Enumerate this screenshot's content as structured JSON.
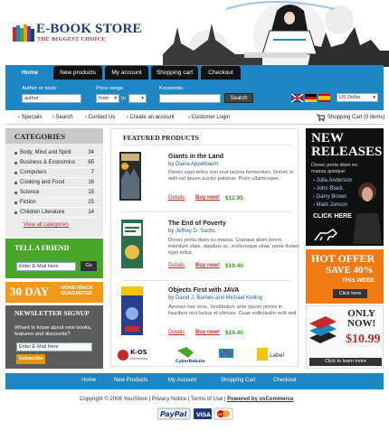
{
  "brand": {
    "title": "E-BOOK STORE",
    "subtitle": "THE BIGGEST CHOICE"
  },
  "nav": {
    "tabs": [
      "Home",
      "New products",
      "My account",
      "Shopping cart",
      "Checkout"
    ]
  },
  "search": {
    "author_label": "Author or book:",
    "author_value": "author",
    "price_label": "Price range:",
    "price_from": "from",
    "price_to": "to",
    "keywords_label": "Keywords:",
    "button": "Search",
    "currency": "US Dollar"
  },
  "subnav": {
    "items": [
      "Specials",
      "Search",
      "Contact Us",
      "Create an account",
      "Customer Login"
    ],
    "cart": "Shopping Cart (0 items)"
  },
  "categories": {
    "title": "CATEGORIES",
    "items": [
      {
        "label": "Body, Mind and Spirit",
        "count": "34"
      },
      {
        "label": "Business & Economics",
        "count": "65"
      },
      {
        "label": "Computers",
        "count": "7"
      },
      {
        "label": "Cooking and Food",
        "count": "16"
      },
      {
        "label": "Science",
        "count": "15"
      },
      {
        "label": "Fiction",
        "count": "25"
      },
      {
        "label": "Children Literature",
        "count": "14"
      }
    ],
    "view_all": "View all categories"
  },
  "tell_friend": {
    "title": "TELL A FRIEND",
    "placeholder": "Enter E-Mail Here",
    "button": "Go"
  },
  "guarantee": {
    "big": "30 DAY",
    "line1": "MONEYBACK",
    "line2": "GUARANTEE"
  },
  "newsletter": {
    "title": "NEWSLETTER SIGNUP",
    "text": "Whant to know about new books, features and discounts?",
    "placeholder": "Enter E-Mail Here",
    "button": "Subscribe"
  },
  "featured": {
    "title": "FEATURED PRODUCTS",
    "products": [
      {
        "title": "Giants in the Land",
        "author": "by Diana Appelbaum",
        "desc": "Donec eget tellus non erat lacinia fermentum. Donec in velit vel ipsum auctor pulvinar. Proin ullamcorper.",
        "details": "Details",
        "buy": "Buy now!",
        "price": "$12.95",
        "cover_title": "GIANTS IN THE LAND"
      },
      {
        "title": "The End of Poverty",
        "author": "by Jeffrey D. Sachs",
        "desc": "Donec porta diam eu massa. Quisque diam lorem, interdum vitae, dapibus ac, scelerisque vitae, pede donec eget tellus.",
        "details": "Details",
        "buy": "Buy now!",
        "price": "$19.40",
        "cover_title": "THE END OF POVERTY"
      },
      {
        "title": "Objects First with JAVA",
        "author": "by David J. Barnes and Michael Kolling",
        "desc": "Aenean nec eros. Vestibulum ante ipsum primis in faucibus orci luctus et ultrices. Cuae sollicitudin velit sed.",
        "details": "Details",
        "buy": "Buy now!",
        "price": "$19.40",
        "cover_title": "Objects First with Java"
      }
    ],
    "partners": [
      "K-OS Multimedia",
      "CyberRebate",
      "Web Search",
      "Label"
    ]
  },
  "promos": {
    "new_releases": {
      "title1": "NEW",
      "title2": "RELEASES",
      "text": "Donec porta diam eu massa quisque:",
      "authors": [
        "Julia Anderson",
        "John Black",
        "Garry Brown",
        "Mark Jonson"
      ],
      "cta": "CLICK HERE"
    },
    "hot_offer": {
      "title": "HOT OFFER",
      "save": "SAVE 40%",
      "week": "THIS WEEK",
      "cta": "Click here"
    },
    "only_now": {
      "line1": "ONLY",
      "line2": "NOW!",
      "price": "$10.99",
      "cta": "Click to learn more"
    }
  },
  "footer": {
    "links": [
      "Home",
      "New Products",
      "My Account",
      "Shopping Cart",
      "Checkout"
    ],
    "copyright": "Copyright © 2006 YourStore",
    "privacy": "Privacy Notice",
    "terms": "Terms of Use",
    "powered": "Powered by osCommerce",
    "payments": [
      "PayPal",
      "VISA",
      "MC"
    ]
  },
  "colors": {
    "primary": "#1f86c4",
    "dark": "#111111",
    "green": "#4aa628",
    "orange": "#f29a18",
    "red": "#c4292c"
  }
}
